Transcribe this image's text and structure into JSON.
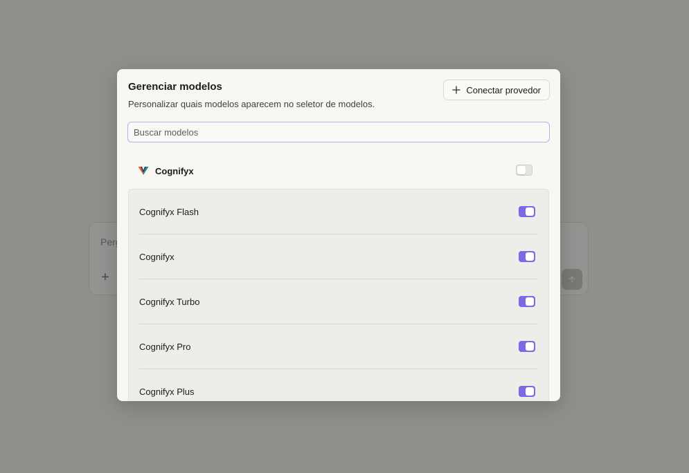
{
  "background": {
    "composer_placeholder": "Perg",
    "plus_icon": "plus-icon",
    "send_icon": "arrow-up-icon"
  },
  "dialog": {
    "title": "Gerenciar modelos",
    "description": "Personalizar quais modelos aparecem no seletor de modelos.",
    "connect_button": "Conectar provedor",
    "search_placeholder": "Buscar modelos",
    "provider": {
      "name": "Cognifyx",
      "enabled": false
    },
    "models": [
      {
        "name": "Cognifyx Flash",
        "enabled": true
      },
      {
        "name": "Cognifyx",
        "enabled": true
      },
      {
        "name": "Cognifyx Turbo",
        "enabled": true
      },
      {
        "name": "Cognifyx Pro",
        "enabled": true
      },
      {
        "name": "Cognifyx Plus",
        "enabled": true
      }
    ]
  },
  "colors": {
    "accent": "#7a6ae6",
    "search_border": "#b5b2ee"
  }
}
